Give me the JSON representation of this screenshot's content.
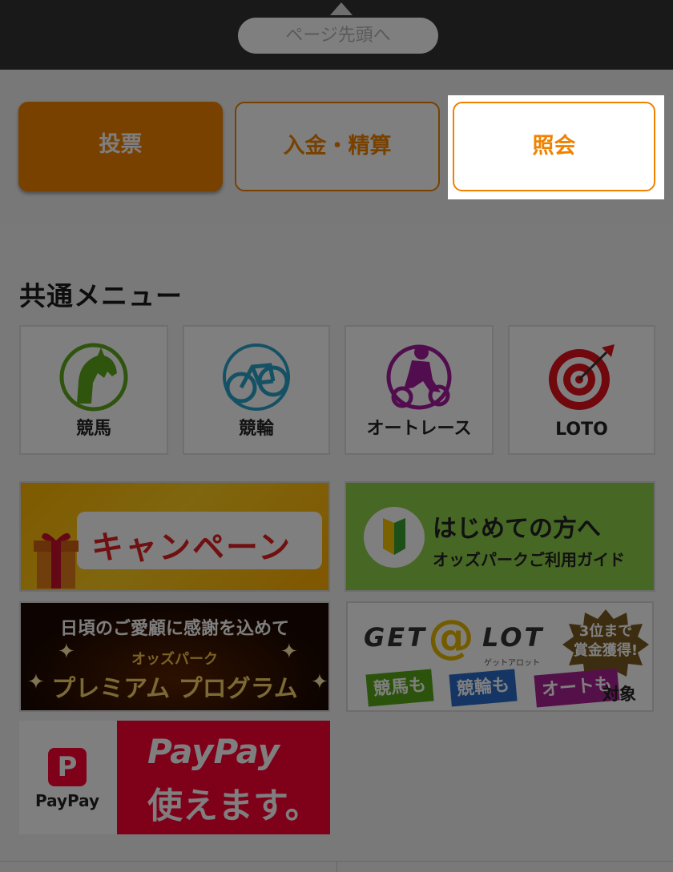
{
  "page_top": {
    "label": "ページ先頭へ"
  },
  "tabs": [
    {
      "label": "投票"
    },
    {
      "label": "入金・精算"
    },
    {
      "label": "照会"
    }
  ],
  "section": {
    "title": "共通メニュー"
  },
  "menu": [
    {
      "label": "競馬",
      "icon": "horse-icon",
      "color": "#5fa81b"
    },
    {
      "label": "競輪",
      "icon": "bicycle-icon",
      "color": "#2aa2c8"
    },
    {
      "label": "オートレース",
      "icon": "motorcycle-icon",
      "color": "#a21a9a"
    },
    {
      "label": "LOTO",
      "icon": "target-icon",
      "color": "#e0101a"
    }
  ],
  "banners": {
    "campaign": {
      "text": "キャンペーン"
    },
    "beginner": {
      "title": "はじめての方へ",
      "subtitle": "オッズパークご利用ガイド"
    },
    "premium": {
      "line1": "日頃のご愛顧に感謝を込めて",
      "line2": "オッズパーク",
      "line3": "プレミアム プログラム"
    },
    "getalot": {
      "logo_left": "GET",
      "logo_at": "@",
      "logo_right": "LOT",
      "sub": "ゲットアロット",
      "burst_line1": "3位まで",
      "burst_line2": "賞金獲得!",
      "tag_keiba": "競馬も",
      "tag_keirin": "競輪も",
      "tag_auto": "オートも",
      "target": "対象"
    },
    "paypay": {
      "brand": "PayPay",
      "line1": "PayPay",
      "line2": "使えます。"
    }
  },
  "colors": {
    "accent": "#f08200",
    "dark_bar": "#333333"
  }
}
